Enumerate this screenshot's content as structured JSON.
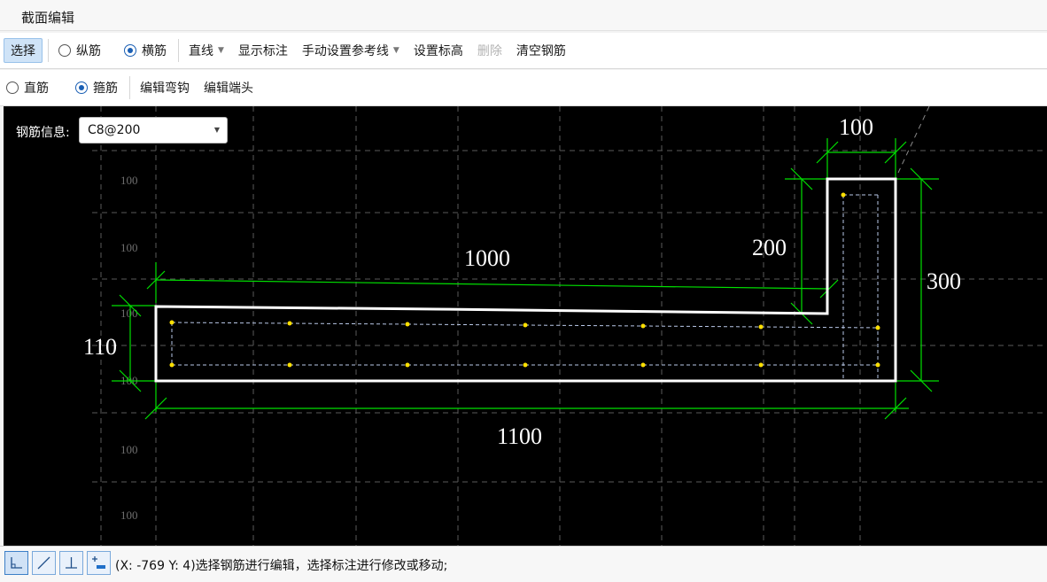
{
  "window": {
    "title": "截面编辑"
  },
  "toolbar1": {
    "select_label": "选择",
    "longitudinal_label": "纵筋",
    "transverse_label": "横筋",
    "transverse_selected": true,
    "line_label": "直线",
    "show_dimensions_label": "显示标注",
    "manual_reference_label": "手动设置参考线",
    "set_elevation_label": "设置标高",
    "delete_label": "删除",
    "clear_rebar_label": "清空钢筋"
  },
  "toolbar2": {
    "straight_label": "直筋",
    "stirrup_label": "箍筋",
    "stirrup_selected": true,
    "edit_hook_label": "编辑弯钩",
    "edit_end_label": "编辑端头"
  },
  "canvas": {
    "rebar_info_label": "钢筋信息:",
    "rebar_info_value": "C8@200",
    "grid_labels": [
      "100",
      "100",
      "100",
      "100",
      "100",
      "100"
    ],
    "dimensions": {
      "top_length": "1000",
      "bottom_length": "1100",
      "left_height": "110",
      "right_height": "300",
      "stem_width": "100",
      "stem_height": "200"
    },
    "colors": {
      "background": "#000000",
      "outline": "#ffffff",
      "dimension": "#00e000",
      "rebar": "#ffe000",
      "grid": "#5a5a5a"
    }
  },
  "statusbar": {
    "snap_buttons": [
      "orthogonal-snap",
      "free-line",
      "perpendicular-snap",
      "add-point"
    ],
    "status_text": "(X: -769 Y: 4)选择钢筋进行编辑，选择标注进行修改或移动;"
  }
}
